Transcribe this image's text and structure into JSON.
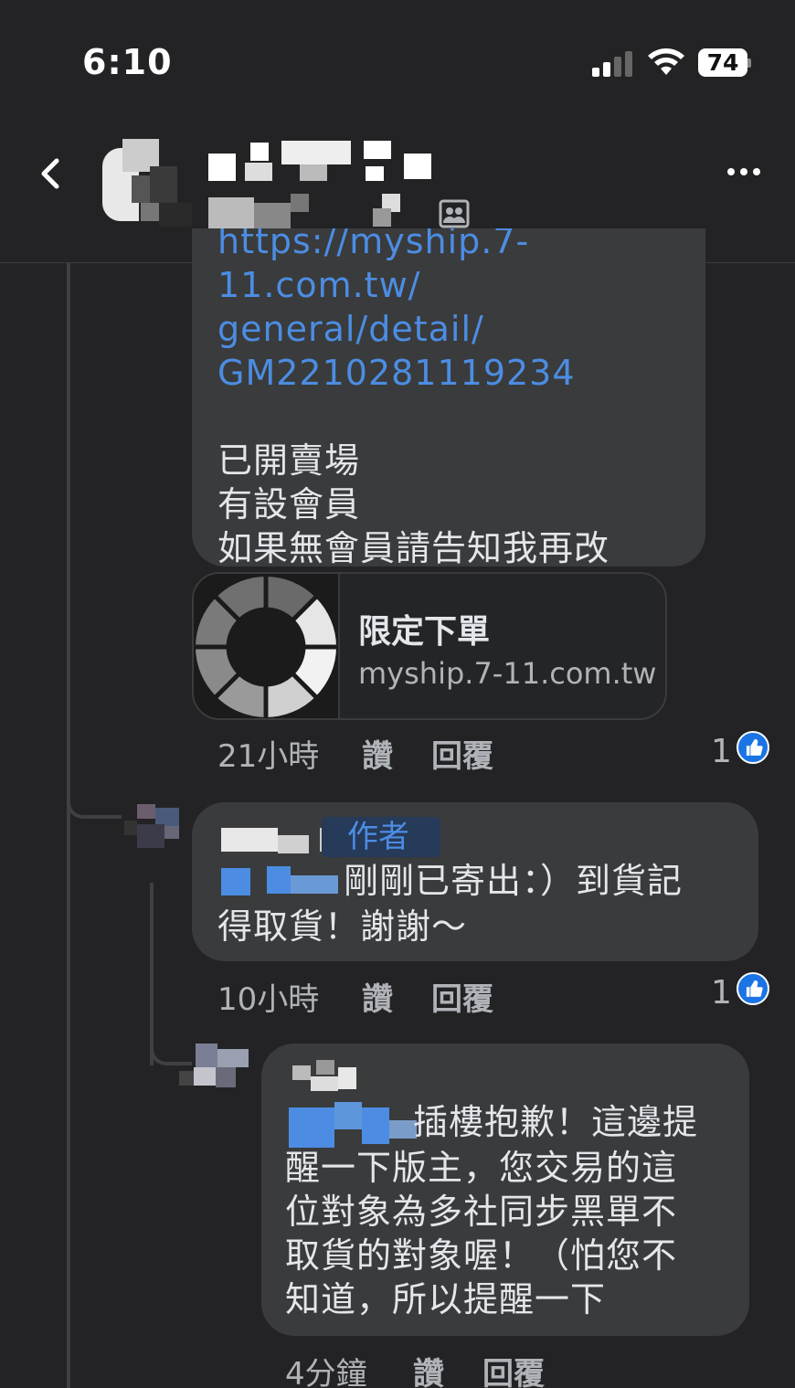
{
  "status_bar": {
    "time": "6:10",
    "battery": "74"
  },
  "header": {
    "group_name": "",
    "group_subtitle": ""
  },
  "comment1": {
    "link_lines": [
      "https://myship.7-11.com.tw/",
      "general/detail/",
      "GM2210281119234"
    ],
    "text_lines": [
      "已開賣場",
      "有設會員",
      "如果無會員請告知我再改"
    ],
    "card": {
      "title": "限定下單",
      "domain": "myship.7-11.com.tw"
    },
    "time": "21小時",
    "like_label": "讚",
    "reply_label": "回覆",
    "like_count": "1"
  },
  "comment2": {
    "author_badge": "作者",
    "text_line1": "剛剛已寄出：）到貨記",
    "text_line2": "得取貨！謝謝～",
    "time": "10小時",
    "like_label": "讚",
    "reply_label": "回覆",
    "like_count": "1"
  },
  "comment3": {
    "text_line1": "插樓抱歉！這邊提",
    "text_lines": [
      "醒一下版主，您交易的這",
      "位對象為多社同步黑單不",
      "取貨的對象喔！（怕您不",
      "知道，所以提醒一下"
    ],
    "time": "4分鐘",
    "like_label": "讚",
    "reply_label": "回覆"
  },
  "colors": {
    "background": "#232325",
    "bubble": "#3a3b3c",
    "link": "#4c8de3",
    "like_blue": "#1b74e4"
  }
}
